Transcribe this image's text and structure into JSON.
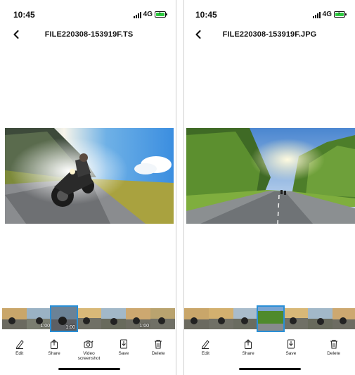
{
  "left_screen": {
    "status": {
      "time": "10:45",
      "network": "4G"
    },
    "title": "FILE220308-153919F.TS",
    "thumbnails": [
      {
        "duration": ""
      },
      {
        "duration": "1:00"
      },
      {
        "duration": "1:00",
        "selected": true
      },
      {
        "duration": ""
      },
      {
        "duration": ""
      },
      {
        "duration": "1:00"
      },
      {
        "duration": ""
      }
    ],
    "toolbar": {
      "edit_label": "Edit",
      "share_label": "Share",
      "video_screenshot_label": "Video screenshot",
      "save_label": "Save",
      "delete_label": "Delete"
    }
  },
  "right_screen": {
    "status": {
      "time": "10:45",
      "network": "4G"
    },
    "title": "FILE220308-153919F.JPG",
    "toolbar": {
      "edit_label": "Edit",
      "share_label": "Share",
      "save_label": "Save",
      "delete_label": "Delete"
    }
  },
  "colors": {
    "accent": "#2a8fd6",
    "battery": "#2ecc40"
  }
}
